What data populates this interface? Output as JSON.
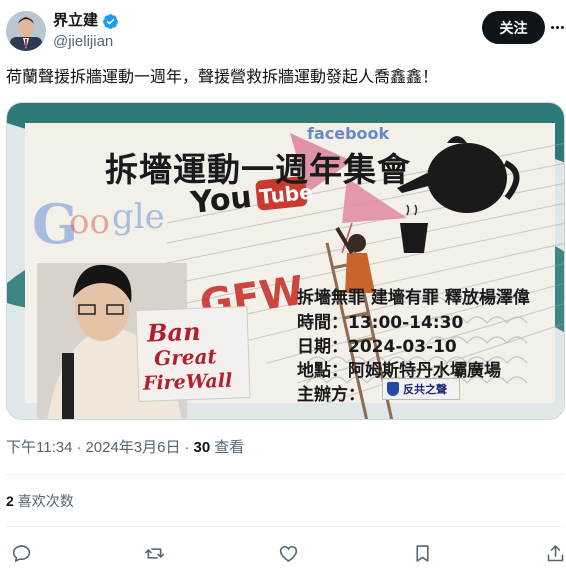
{
  "user": {
    "display_name": "界立建",
    "handle": "@jielijian",
    "follow_label": "关注"
  },
  "tweet": {
    "text": "荷蘭聲援拆牆運動一週年，聲援營救拆牆運動發起人喬鑫鑫！"
  },
  "media": {
    "poster_title": "拆墻運動一週年集會",
    "slogan": "拆墻無罪 建墻有罪 釋放楊澤偉",
    "time_line": "時間：13:00-14:30",
    "date_line": "日期：2024-03-10",
    "place_line": "地點：阿姆斯特丹水壩廣場",
    "organizer_label": "主辦方：",
    "organizer_name": "反共之聲",
    "sign_line1": "Ban",
    "sign_line2": "Great",
    "sign_line3": "FireWall",
    "brand_youtube": "YouTube",
    "brand_google": "Google",
    "brand_facebook": "Facebook",
    "gfw_text": "GFW"
  },
  "meta": {
    "time": "下午11:34",
    "separator": "·",
    "date": "2024年3月6日",
    "separator2": "·",
    "views_count": "30",
    "views_label": "查看"
  },
  "engagement": {
    "likes_count": "2",
    "likes_label": "喜欢次数"
  },
  "icons": {
    "reply": "reply-icon",
    "retweet": "retweet-icon",
    "like": "heart-icon",
    "bookmark": "bookmark-icon",
    "share": "share-icon"
  },
  "colors": {
    "verified_blue": "#1d9bf0",
    "follow_bg": "#0f1419",
    "meta_gray": "#536471"
  }
}
